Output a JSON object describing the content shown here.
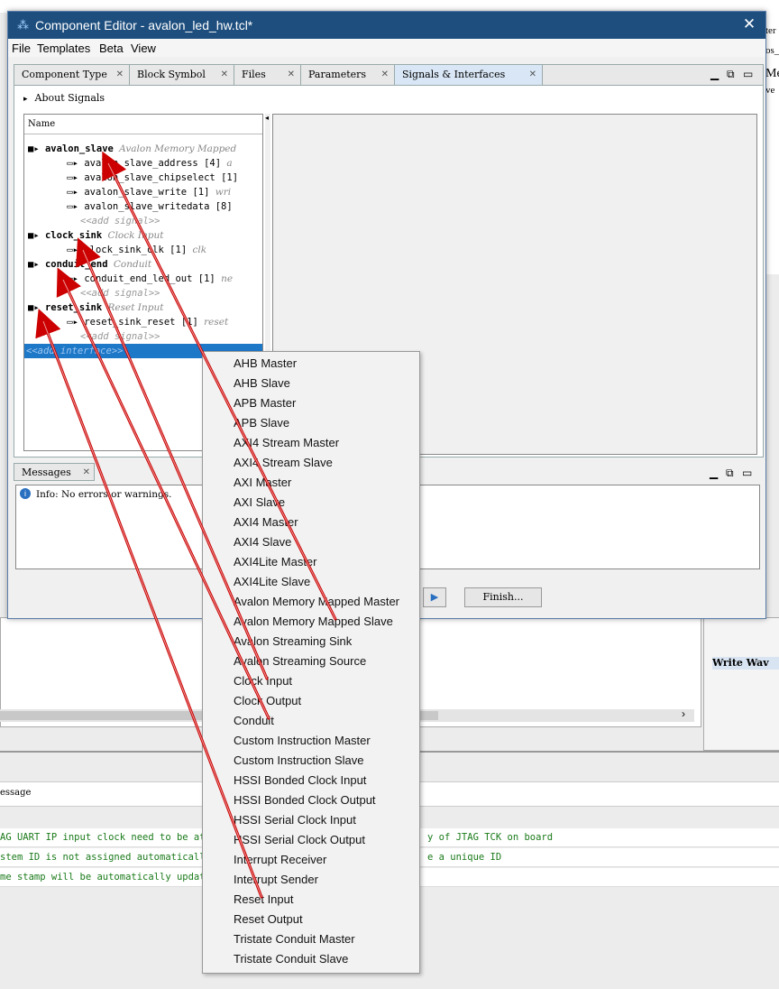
{
  "window": {
    "title": "Component Editor - avalon_led_hw.tcl*"
  },
  "menu": [
    "File",
    "Templates",
    "Beta",
    "View"
  ],
  "tabs": [
    "Component Type",
    "Block Symbol",
    "Files",
    "Parameters",
    "Signals & Interfaces"
  ],
  "about": "About Signals",
  "tree": {
    "header": "Name",
    "rows": [
      {
        "kind": "iface",
        "name": "avalon_slave",
        "type": "Avalon Memory Mapped"
      },
      {
        "kind": "signal",
        "name": "avalon_slave_address",
        "width": "[4]",
        "role": "a"
      },
      {
        "kind": "signal",
        "name": "avalon_slave_chipselect",
        "width": "[1]",
        "role": ""
      },
      {
        "kind": "signal",
        "name": "avalon_slave_write",
        "width": "[1]",
        "role": "wri"
      },
      {
        "kind": "signal",
        "name": "avalon_slave_writedata",
        "width": "[8]",
        "role": ""
      },
      {
        "kind": "add",
        "name": "<<add signal>>"
      },
      {
        "kind": "iface",
        "name": "clock_sink",
        "type": "Clock Input"
      },
      {
        "kind": "signal",
        "name": "clock_sink_clk",
        "width": "[1]",
        "role": "clk"
      },
      {
        "kind": "iface",
        "name": "conduit_end",
        "type": "Conduit"
      },
      {
        "kind": "signal",
        "name": "conduit_end_led_out",
        "width": "[1]",
        "role": "ne"
      },
      {
        "kind": "add",
        "name": "<<add signal>>"
      },
      {
        "kind": "iface",
        "name": "reset_sink",
        "type": "Reset Input"
      },
      {
        "kind": "signal",
        "name": "reset_sink_reset",
        "width": "[1]",
        "role": "reset"
      },
      {
        "kind": "add",
        "name": "<<add signal>>"
      },
      {
        "kind": "addiface",
        "name": "<<add interface>>"
      }
    ]
  },
  "messages": {
    "tab": "Messages",
    "info": "Info: No errors or warnings."
  },
  "buttons": {
    "finish": "Finish..."
  },
  "popup": [
    "AHB Master",
    "AHB Slave",
    "APB Master",
    "APB Slave",
    "AXI4 Stream Master",
    "AXI4 Stream Slave",
    "AXI Master",
    "AXI Slave",
    "AXI4 Master",
    "AXI4 Slave",
    "AXI4Lite Master",
    "AXI4Lite Slave",
    "Avalon Memory Mapped Master",
    "Avalon Memory Mapped Slave",
    "Avalon Streaming Sink",
    "Avalon Streaming Source",
    "Clock Input",
    "Clock Output",
    "Conduit",
    "Custom Instruction Master",
    "Custom Instruction Slave",
    "HSSI Bonded Clock Input",
    "HSSI Bonded Clock Output",
    "HSSI Serial Clock Input",
    "HSSI Serial Clock Output",
    "Interrupt Receiver",
    "Interrupt Sender",
    "Reset Input",
    "Reset Output",
    "Tristate Conduit Master",
    "Tristate Conduit Slave"
  ],
  "background": {
    "message_header": "essage",
    "log": [
      "AG UART IP input clock need to be at",
      "stem ID is not assigned automatically",
      "me stamp will be automatically update"
    ],
    "log_right": [
      "y of JTAG TCK on board",
      "e a unique ID"
    ],
    "write_label": "Write Wav",
    "right_snips": [
      "ter",
      "os_",
      "Me",
      "ve"
    ]
  },
  "colors": {
    "title_bar": "#1d4e7e",
    "selection": "#1e78c8",
    "arrow": "#cc0000"
  }
}
